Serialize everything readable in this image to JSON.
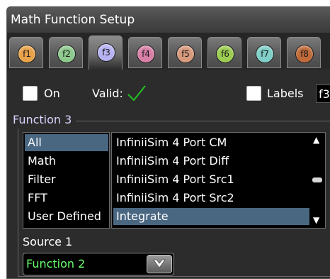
{
  "window": {
    "title": "Math Function Setup"
  },
  "tabs": [
    {
      "label": "f1",
      "color": "#e8a24a"
    },
    {
      "label": "f2",
      "color": "#8ec98e"
    },
    {
      "label": "f3",
      "color": "#b7b2f2",
      "active": true
    },
    {
      "label": "f4",
      "color": "#d77fa6"
    },
    {
      "label": "f5",
      "color": "#d79a7c"
    },
    {
      "label": "f6",
      "color": "#9ccc52"
    },
    {
      "label": "f7",
      "color": "#7fcfc8"
    },
    {
      "label": "f8",
      "color": "#c06a3a"
    }
  ],
  "controls": {
    "on_label": "On",
    "on_checked": false,
    "valid_label": "Valid:",
    "valid_icon": "check-icon",
    "valid_color": "#22c322",
    "labels_label": "Labels",
    "labels_checked": false,
    "labels_value": "f3"
  },
  "group": {
    "title": "Function 3"
  },
  "categories": [
    "All",
    "Math",
    "Filter",
    "FFT",
    "User Defined"
  ],
  "selected_category": "All",
  "functions": [
    "InfiniiSim 4 Port CM",
    "InfiniiSim 4 Port Diff",
    "InfiniiSim 4 Port Src1",
    "InfiniiSim 4 Port Src2",
    "Integrate"
  ],
  "selected_function": "Integrate",
  "scrollbar": {
    "up_icon": "scroll-up-icon",
    "down_icon": "scroll-down-icon"
  },
  "source1": {
    "label": "Source 1",
    "value": "Function 2",
    "value_color": "#6cff6c",
    "button_icon": "chevron-down-icon"
  },
  "colors": {
    "background": "#2c2c2c",
    "selection": "#4a6782",
    "group_title": "#d9d4ff"
  }
}
